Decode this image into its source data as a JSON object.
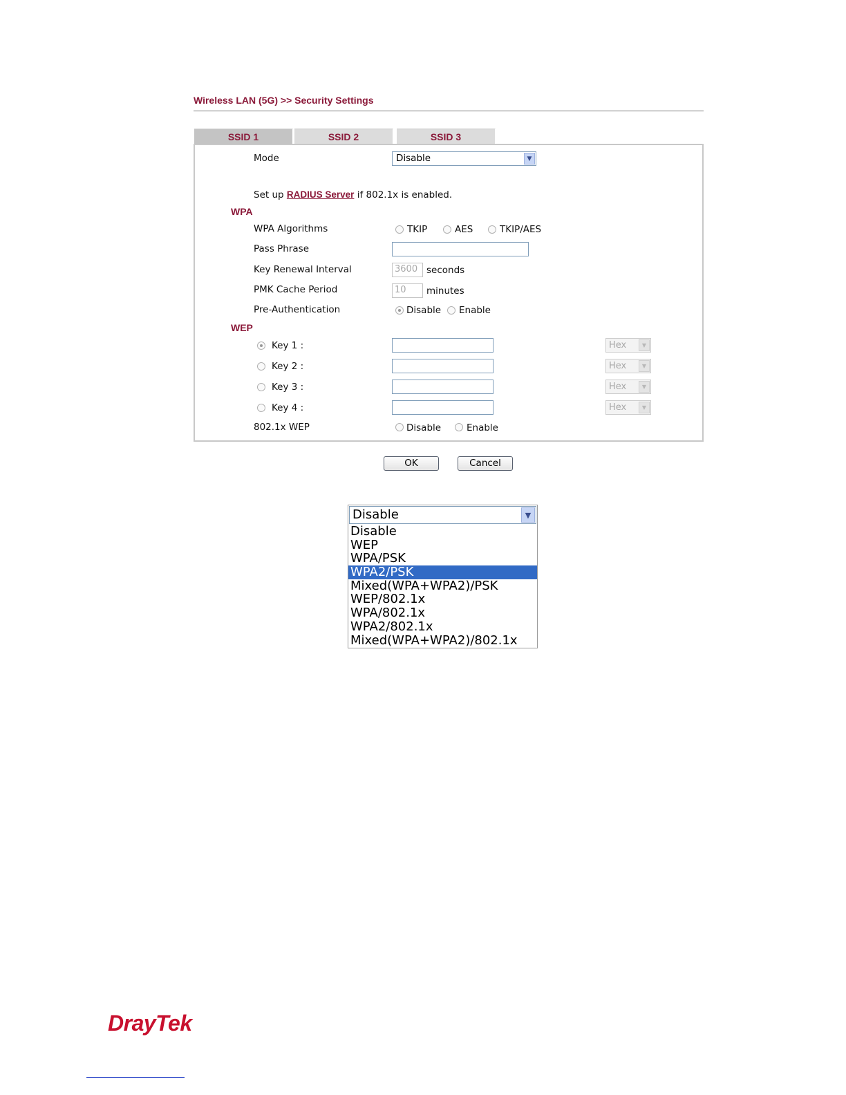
{
  "header": {
    "title": "Wireless LAN (5G) >> Security Settings"
  },
  "tabs": [
    {
      "label": "SSID 1",
      "active": true
    },
    {
      "label": "SSID 2",
      "active": false
    },
    {
      "label": "SSID 3",
      "active": false
    }
  ],
  "form": {
    "mode": {
      "label": "Mode",
      "value": "Disable"
    },
    "radius": {
      "prefix": "Set up",
      "link": "RADIUS Server",
      "suffix": "if 802.1x is enabled."
    },
    "wpa": {
      "section": "WPA",
      "algorithms": {
        "label": "WPA Algorithms",
        "options": [
          "TKIP",
          "AES",
          "TKIP/AES"
        ]
      },
      "pass_phrase": {
        "label": "Pass Phrase",
        "value": ""
      },
      "key_renewal": {
        "label": "Key Renewal Interval",
        "value": "3600",
        "unit": "seconds"
      },
      "pmk_cache": {
        "label": "PMK Cache Period",
        "value": "10",
        "unit": "minutes"
      },
      "pre_auth": {
        "label": "Pre-Authentication",
        "options": [
          "Disable",
          "Enable"
        ],
        "selected": "Disable"
      }
    },
    "wep": {
      "section": "WEP",
      "keys": [
        {
          "label": "Key 1 :",
          "selected": true,
          "format": "Hex"
        },
        {
          "label": "Key 2 :",
          "selected": false,
          "format": "Hex"
        },
        {
          "label": "Key 3 :",
          "selected": false,
          "format": "Hex"
        },
        {
          "label": "Key 4 :",
          "selected": false,
          "format": "Hex"
        }
      ],
      "dot1x_wep": {
        "label": "802.1x WEP",
        "options": [
          "Disable",
          "Enable"
        ]
      }
    }
  },
  "buttons": {
    "ok": "OK",
    "cancel": "Cancel"
  },
  "mode_dropdown": {
    "selected": "Disable",
    "options": [
      "Disable",
      "WEP",
      "WPA/PSK",
      "WPA2/PSK",
      "Mixed(WPA+WPA2)/PSK",
      "WEP/802.1x",
      "WPA/802.1x",
      "WPA2/802.1x",
      "Mixed(WPA+WPA2)/802.1x"
    ],
    "highlighted": "WPA2/PSK"
  },
  "footer": {
    "logo": "DrayTek"
  },
  "icons": {
    "dropdown": "chevron-down-icon",
    "radio": "radio-icon"
  },
  "colors": {
    "accent": "#8b1a3a",
    "highlight": "#316ac5",
    "logo": "#c8102e"
  }
}
